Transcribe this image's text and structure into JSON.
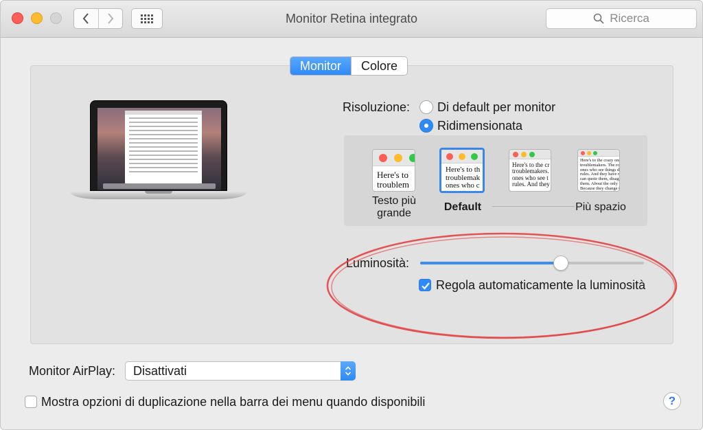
{
  "window": {
    "title": "Monitor Retina integrato"
  },
  "toolbar": {
    "search_placeholder": "Ricerca"
  },
  "tabs": [
    {
      "label": "Monitor",
      "active": true
    },
    {
      "label": "Colore",
      "active": false
    }
  ],
  "resolution": {
    "label": "Risoluzione:",
    "options": [
      {
        "label": "Di default per monitor",
        "selected": false
      },
      {
        "label": "Ridimensionata",
        "selected": true
      }
    ],
    "scales": [
      {
        "preview_text": "Here's to\ntroublem",
        "label": "Testo più\ngrande",
        "selected": false
      },
      {
        "preview_text": "Here's to th\ntroublemak\nones who c",
        "label": "Default",
        "selected": true
      },
      {
        "preview_text": "Here's to the cr\ntroublemakers.\nones who see t\nrules. And they",
        "label": "",
        "selected": false
      },
      {
        "preview_text": "Here's to the crazy one\ntroublemakers. The rou\nones who see things di\nrules. And they have no\ncan quote them, disagr\nthem. About the only th\nBecause they change th",
        "label": "Più spazio",
        "selected": false
      }
    ]
  },
  "brightness": {
    "label": "Luminosità:",
    "level": 0.63,
    "auto_label": "Regola automaticamente la luminosità",
    "auto_checked": true
  },
  "airplay": {
    "label": "Monitor AirPlay:",
    "value": "Disattivati"
  },
  "mirroring": {
    "label": "Mostra opzioni di duplicazione nella barra dei menu quando disponibili",
    "checked": false
  },
  "help": {
    "label": "?"
  },
  "colors": {
    "accent": "#2f8af7",
    "highlight": "#e23b3b"
  }
}
